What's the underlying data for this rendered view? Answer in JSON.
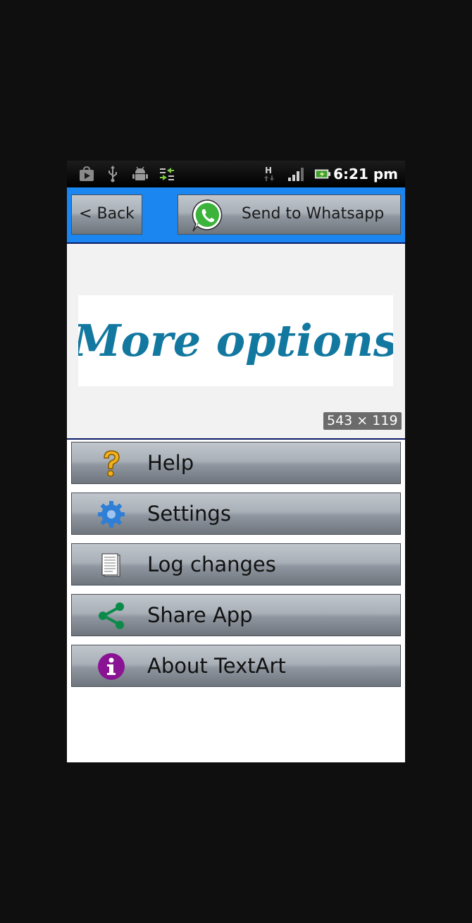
{
  "status_bar": {
    "time": "6:21 pm",
    "icons": [
      "play-store-icon",
      "usb-icon",
      "android-debug-icon",
      "sync-icon",
      "network-h-icon",
      "signal-icon",
      "battery-charging-icon"
    ]
  },
  "toolbar": {
    "back_label": "< Back",
    "whatsapp_label": "Send to Whatsapp"
  },
  "banner": {
    "title": "More options",
    "dimensions": "543 × 119",
    "text_color": "#1278a0"
  },
  "menu": {
    "items": [
      {
        "label": "Help",
        "icon": "help-icon"
      },
      {
        "label": "Settings",
        "icon": "gear-icon"
      },
      {
        "label": "Log changes",
        "icon": "document-icon"
      },
      {
        "label": "Share App",
        "icon": "share-icon"
      },
      {
        "label": "About TextArt",
        "icon": "info-icon"
      }
    ]
  },
  "colors": {
    "toolbar_bg": "#1b86f0",
    "share_icon": "#0c8a4a",
    "info_icon": "#8a1394",
    "help_icon": "#f0b21c",
    "gear_icon": "#2f7fd6"
  }
}
